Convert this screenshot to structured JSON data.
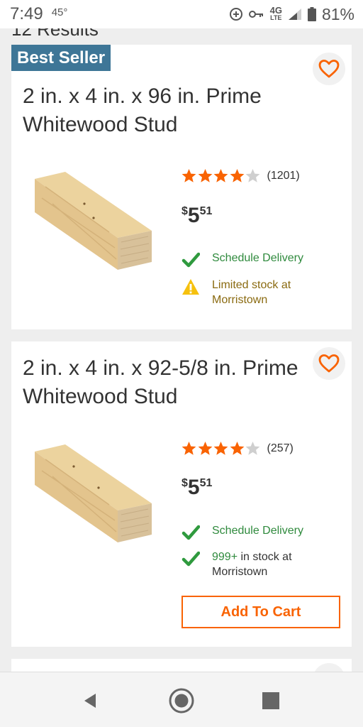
{
  "status_bar": {
    "time": "7:49",
    "temperature": "45°",
    "network": "4G",
    "network_sub": "LTE",
    "battery_percent": "81%"
  },
  "results_peek": "12 Results",
  "products": [
    {
      "badge": "Best Seller",
      "title": "2 in. x 4 in. x 96 in. Prime Whitewood Stud",
      "rating": 4,
      "max_rating": 5,
      "review_count": "(1201)",
      "price": {
        "currency": "$",
        "dollars": "5",
        "cents": "51"
      },
      "fulfillment": [
        {
          "icon": "check-icon",
          "text": "Schedule Delivery"
        },
        {
          "icon": "warning-icon",
          "text": "Limited stock at Morristown"
        }
      ]
    },
    {
      "title": "2 in. x 4 in. x 92-5/8 in. Prime Whitewood Stud",
      "rating": 4,
      "max_rating": 5,
      "review_count": "(257)",
      "price": {
        "currency": "$",
        "dollars": "5",
        "cents": "51"
      },
      "fulfillment": [
        {
          "icon": "check-icon",
          "text": "Schedule Delivery"
        },
        {
          "icon": "check-icon",
          "text_prefix": "999+",
          "text": " in stock at Morristown"
        }
      ],
      "add_to_cart_label": "Add To Cart"
    }
  ],
  "colors": {
    "accent_orange": "#f96302",
    "badge_blue": "#3e7697",
    "star_orange": "#f96302",
    "star_empty": "#cfcfcf",
    "in_stock_green": "#2f8a3d",
    "warning_yellow": "#f6c10e"
  },
  "nav_bar": {
    "icons": [
      "back-icon",
      "home-icon",
      "recents-icon"
    ]
  }
}
